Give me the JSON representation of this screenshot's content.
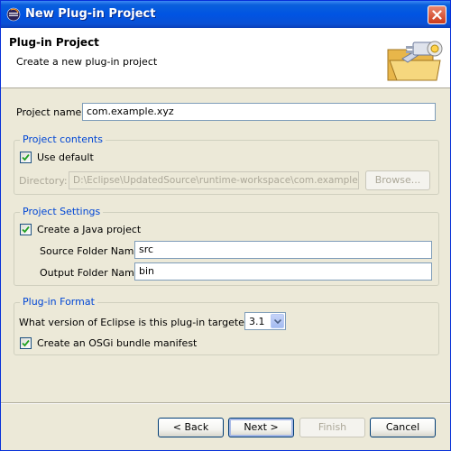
{
  "window": {
    "title": "New Plug-in Project"
  },
  "header": {
    "title": "Plug-in Project",
    "description": "Create a new plug-in project"
  },
  "project_name": {
    "label": "Project name:",
    "value": "com.example.xyz"
  },
  "project_contents": {
    "group_title": "Project contents",
    "use_default_label": "Use default",
    "use_default_checked": true,
    "directory_label": "Directory:",
    "directory_value": "D:\\Eclipse\\UpdatedSource\\runtime-workspace\\com.example.xyz",
    "browse_label": "Browse..."
  },
  "project_settings": {
    "group_title": "Project Settings",
    "java_project_label": "Create a Java project",
    "java_project_checked": true,
    "source_folder_label": "Source Folder Name:",
    "source_folder_value": "src",
    "output_folder_label": "Output Folder Name:",
    "output_folder_value": "bin"
  },
  "plugin_format": {
    "group_title": "Plug-in Format",
    "version_question": "What version of Eclipse is this plug-in targeted for?",
    "version_value": "3.1",
    "osgi_label": "Create an OSGi bundle manifest",
    "osgi_checked": true
  },
  "buttons": {
    "back": "< Back",
    "next": "Next >",
    "finish": "Finish",
    "cancel": "Cancel"
  },
  "colors": {
    "titlebar": "#0054e3",
    "group_title": "#0046d5",
    "dialog_bg": "#ece9d8"
  }
}
